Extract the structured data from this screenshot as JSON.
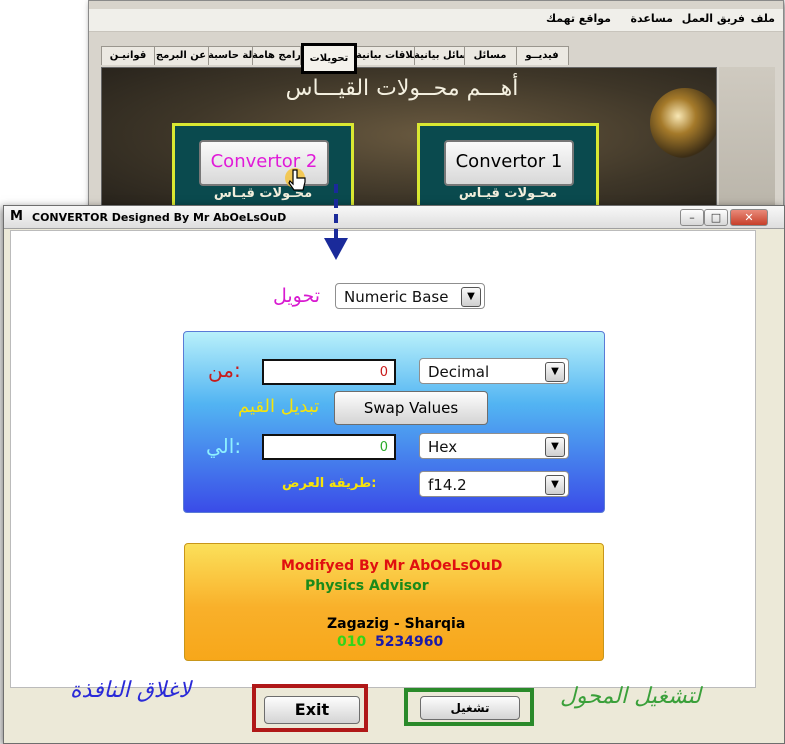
{
  "bg_window": {
    "menu": [
      "ملف",
      "فريق العمل",
      "مساعدة",
      "مواقع تهمك"
    ],
    "tabs": [
      "فيديــو",
      "مسائل",
      "مسائل بيانية",
      "علاقات بيانية",
      "تحويلات",
      "برامج هامة",
      "آلة حاسبة",
      "عن البرمج",
      "قوانيـن"
    ],
    "active_tab": "تحويلات",
    "heading": "أهـــم محــولات القيـــاس",
    "convertor1_label": "Convertor 1",
    "convertor2_label": "Convertor 2",
    "convertor1_sub": "محـولات قيـاس",
    "convertor2_sub": "محـولات قيـاس"
  },
  "window": {
    "icon": "M",
    "title": "CONVERTOR  Designed By Mr AbOeLsOuD",
    "minimize": "–",
    "maximize": "□",
    "close": "✕"
  },
  "convert_type": {
    "label": "تحويل",
    "selected": "Numeric Base"
  },
  "converter": {
    "from_label": "من:",
    "from_value": "0",
    "from_unit": "Decimal",
    "swap_label": "تبديل القيم",
    "swap_button": "Swap Values",
    "to_label": "الي:",
    "to_value": "0",
    "to_unit": "Hex",
    "display_label": "طريقة العرض:",
    "display_format": "f14.2"
  },
  "info": {
    "modified_by": "Modifyed By Mr AbOeLsOuD",
    "role": "Physics Advisor",
    "location": "Zagazig - Sharqia",
    "phone_prefix": "010",
    "phone_number": "5234960"
  },
  "annotations": {
    "close_note": "لاغلاق النافذة",
    "run_note": "لتشغيل المحول"
  },
  "buttons": {
    "exit": "Exit",
    "run": "تشغيل"
  },
  "icons": {
    "dropdown": "▼",
    "cursor": "hand-pointer-icon"
  },
  "colors": {
    "highlight_exit": "#b01818",
    "highlight_run": "#2a8a2a",
    "highlight_tab": "#000000",
    "pointer_arrow": "#1a2a9a"
  }
}
